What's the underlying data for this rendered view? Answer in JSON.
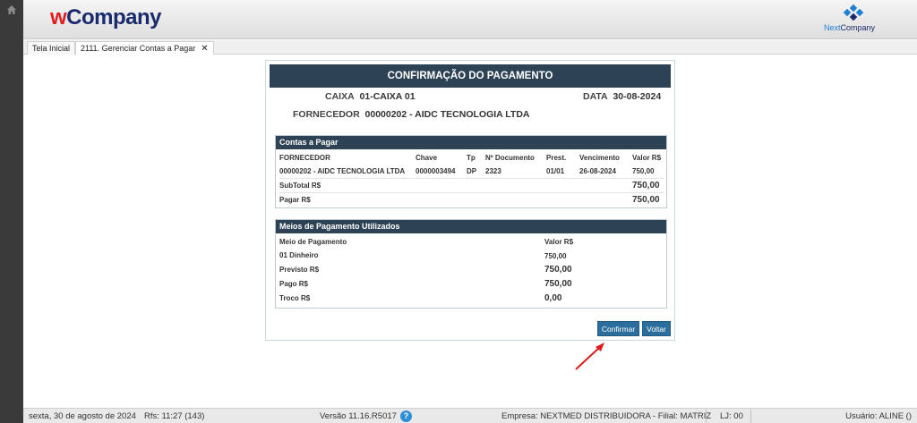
{
  "header": {
    "logo_w": "w",
    "logo_rest": "Company",
    "nc_a": "Next",
    "nc_b": "Company"
  },
  "tabs": [
    {
      "label": "Tela Inicial"
    },
    {
      "label": "2111. Gerenciar Contas a Pagar",
      "close": "✕"
    }
  ],
  "dialog": {
    "title": "CONFIRMAÇÃO DO PAGAMENTO",
    "caixa_label": "CAIXA",
    "caixa_value": "01-CAIXA 01",
    "data_label": "DATA",
    "data_value": "30-08-2024",
    "fornecedor_label": "FORNECEDOR",
    "fornecedor_value": "00000202 - AIDC TECNOLOGIA LTDA"
  },
  "contas": {
    "title": "Contas a Pagar",
    "headers": [
      "FORNECEDOR",
      "Chave",
      "Tp",
      "Nº Documento",
      "Prest.",
      "Vencimento",
      "Valor R$"
    ],
    "row": [
      "00000202 - AIDC TECNOLOGIA LTDA",
      "0000003494",
      "DP",
      "2323",
      "01/01",
      "26-08-2024",
      "750,00"
    ],
    "subtotal_label": "SubTotal R$",
    "subtotal_value": "750,00",
    "pagar_label": "Pagar R$",
    "pagar_value": "750,00"
  },
  "meios": {
    "title": "Meios de Pagamento Utilizados",
    "header_meio": "Meio de Pagamento",
    "header_valor": "Valor R$",
    "item_label": "01 Dinheiro",
    "item_value": "750,00",
    "previsto_label": "Previsto R$",
    "previsto_value": "750,00",
    "pago_label": "Pago R$",
    "pago_value": "750,00",
    "troco_label": "Troco R$",
    "troco_value": "0,00"
  },
  "buttons": {
    "confirmar": "Confirmar",
    "voltar": "Voltar"
  },
  "status": {
    "date": "sexta, 30 de agosto de 2024",
    "rfs": "Rfs: 11:27 (143)",
    "version": "Versão 11.16.R5017",
    "help": "?",
    "empresa": "Empresa: NEXTMED DISTRIBUIDORA - Filial: MATRIZ",
    "lj": "LJ: 00",
    "usuario": "Usuário: ALINE ()"
  },
  "colors": {
    "header_dark": "#2d4355",
    "button": "#2b6d9c",
    "arrow": "#e01b1b",
    "logo_red": "#e02020",
    "logo_navy": "#1a2a6c"
  }
}
